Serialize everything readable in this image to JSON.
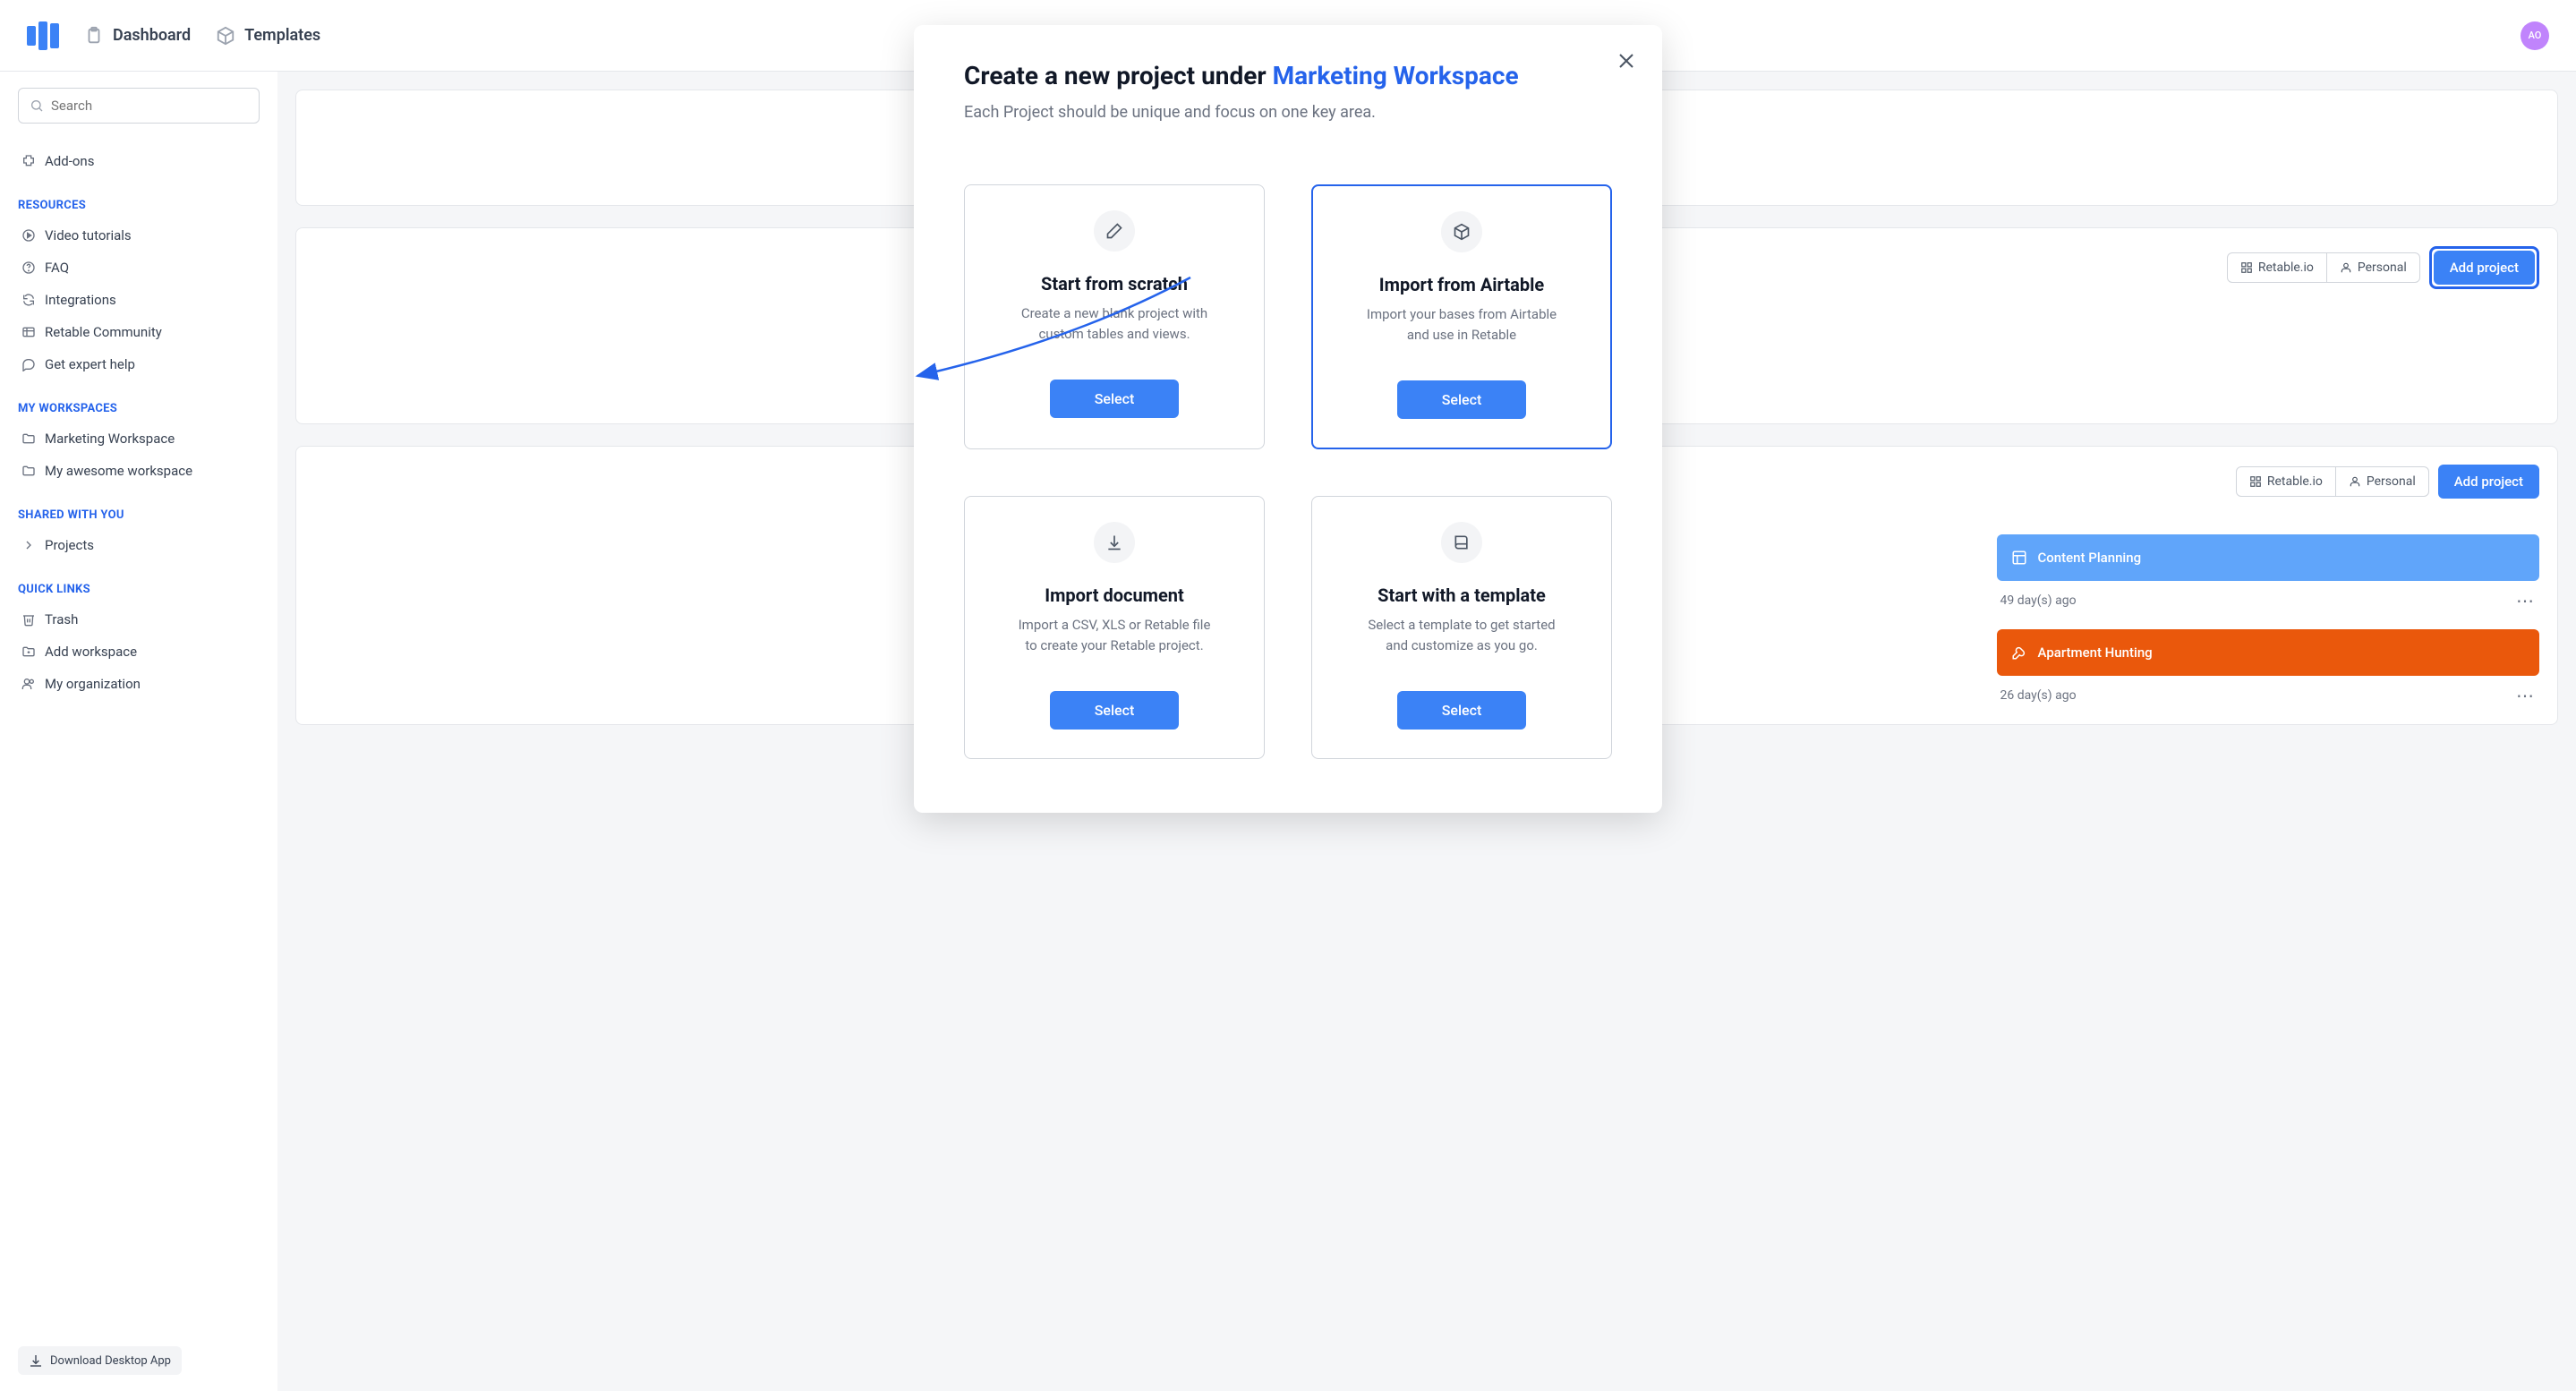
{
  "nav": {
    "dashboard": "Dashboard",
    "templates": "Templates"
  },
  "avatar_initials": "AO",
  "search_placeholder": "Search",
  "sidebar": {
    "addons": "Add-ons",
    "resources_title": "RESOURCES",
    "resources": {
      "video": "Video tutorials",
      "faq": "FAQ",
      "integrations": "Integrations",
      "community": "Retable Community",
      "expert": "Get expert help"
    },
    "workspaces_title": "MY WORKSPACES",
    "workspaces": {
      "marketing": "Marketing Workspace",
      "awesome": "My awesome workspace"
    },
    "shared_title": "SHARED WITH YOU",
    "shared": {
      "projects": "Projects"
    },
    "quick_title": "QUICK LINKS",
    "quick": {
      "trash": "Trash",
      "add_workspace": "Add workspace",
      "org": "My organization"
    },
    "download": "Download Desktop App"
  },
  "workspace_header": {
    "segment_retable": "Retable.io",
    "segment_personal": "Personal",
    "add_project": "Add project"
  },
  "projects": {
    "content": {
      "name": "Content Planning",
      "ago": "49 day(s) ago"
    },
    "apartment": {
      "name": "Apartment Hunting",
      "ago": "26 day(s) ago"
    }
  },
  "modal": {
    "title_prefix": "Create a new project under ",
    "title_accent": "Marketing Workspace",
    "subtitle": "Each Project should be unique and focus on one key area.",
    "options": {
      "scratch": {
        "title": "Start from scratch",
        "desc": "Create a new blank project with custom tables and views.",
        "button": "Select"
      },
      "airtable": {
        "title": "Import from Airtable",
        "desc": "Import your bases from Airtable and use in Retable",
        "button": "Select"
      },
      "document": {
        "title": "Import document",
        "desc": "Import a CSV, XLS or Retable file to create your Retable project.",
        "button": "Select"
      },
      "template": {
        "title": "Start with a template",
        "desc": "Select a template to get started and customize as you go.",
        "button": "Select"
      }
    }
  }
}
